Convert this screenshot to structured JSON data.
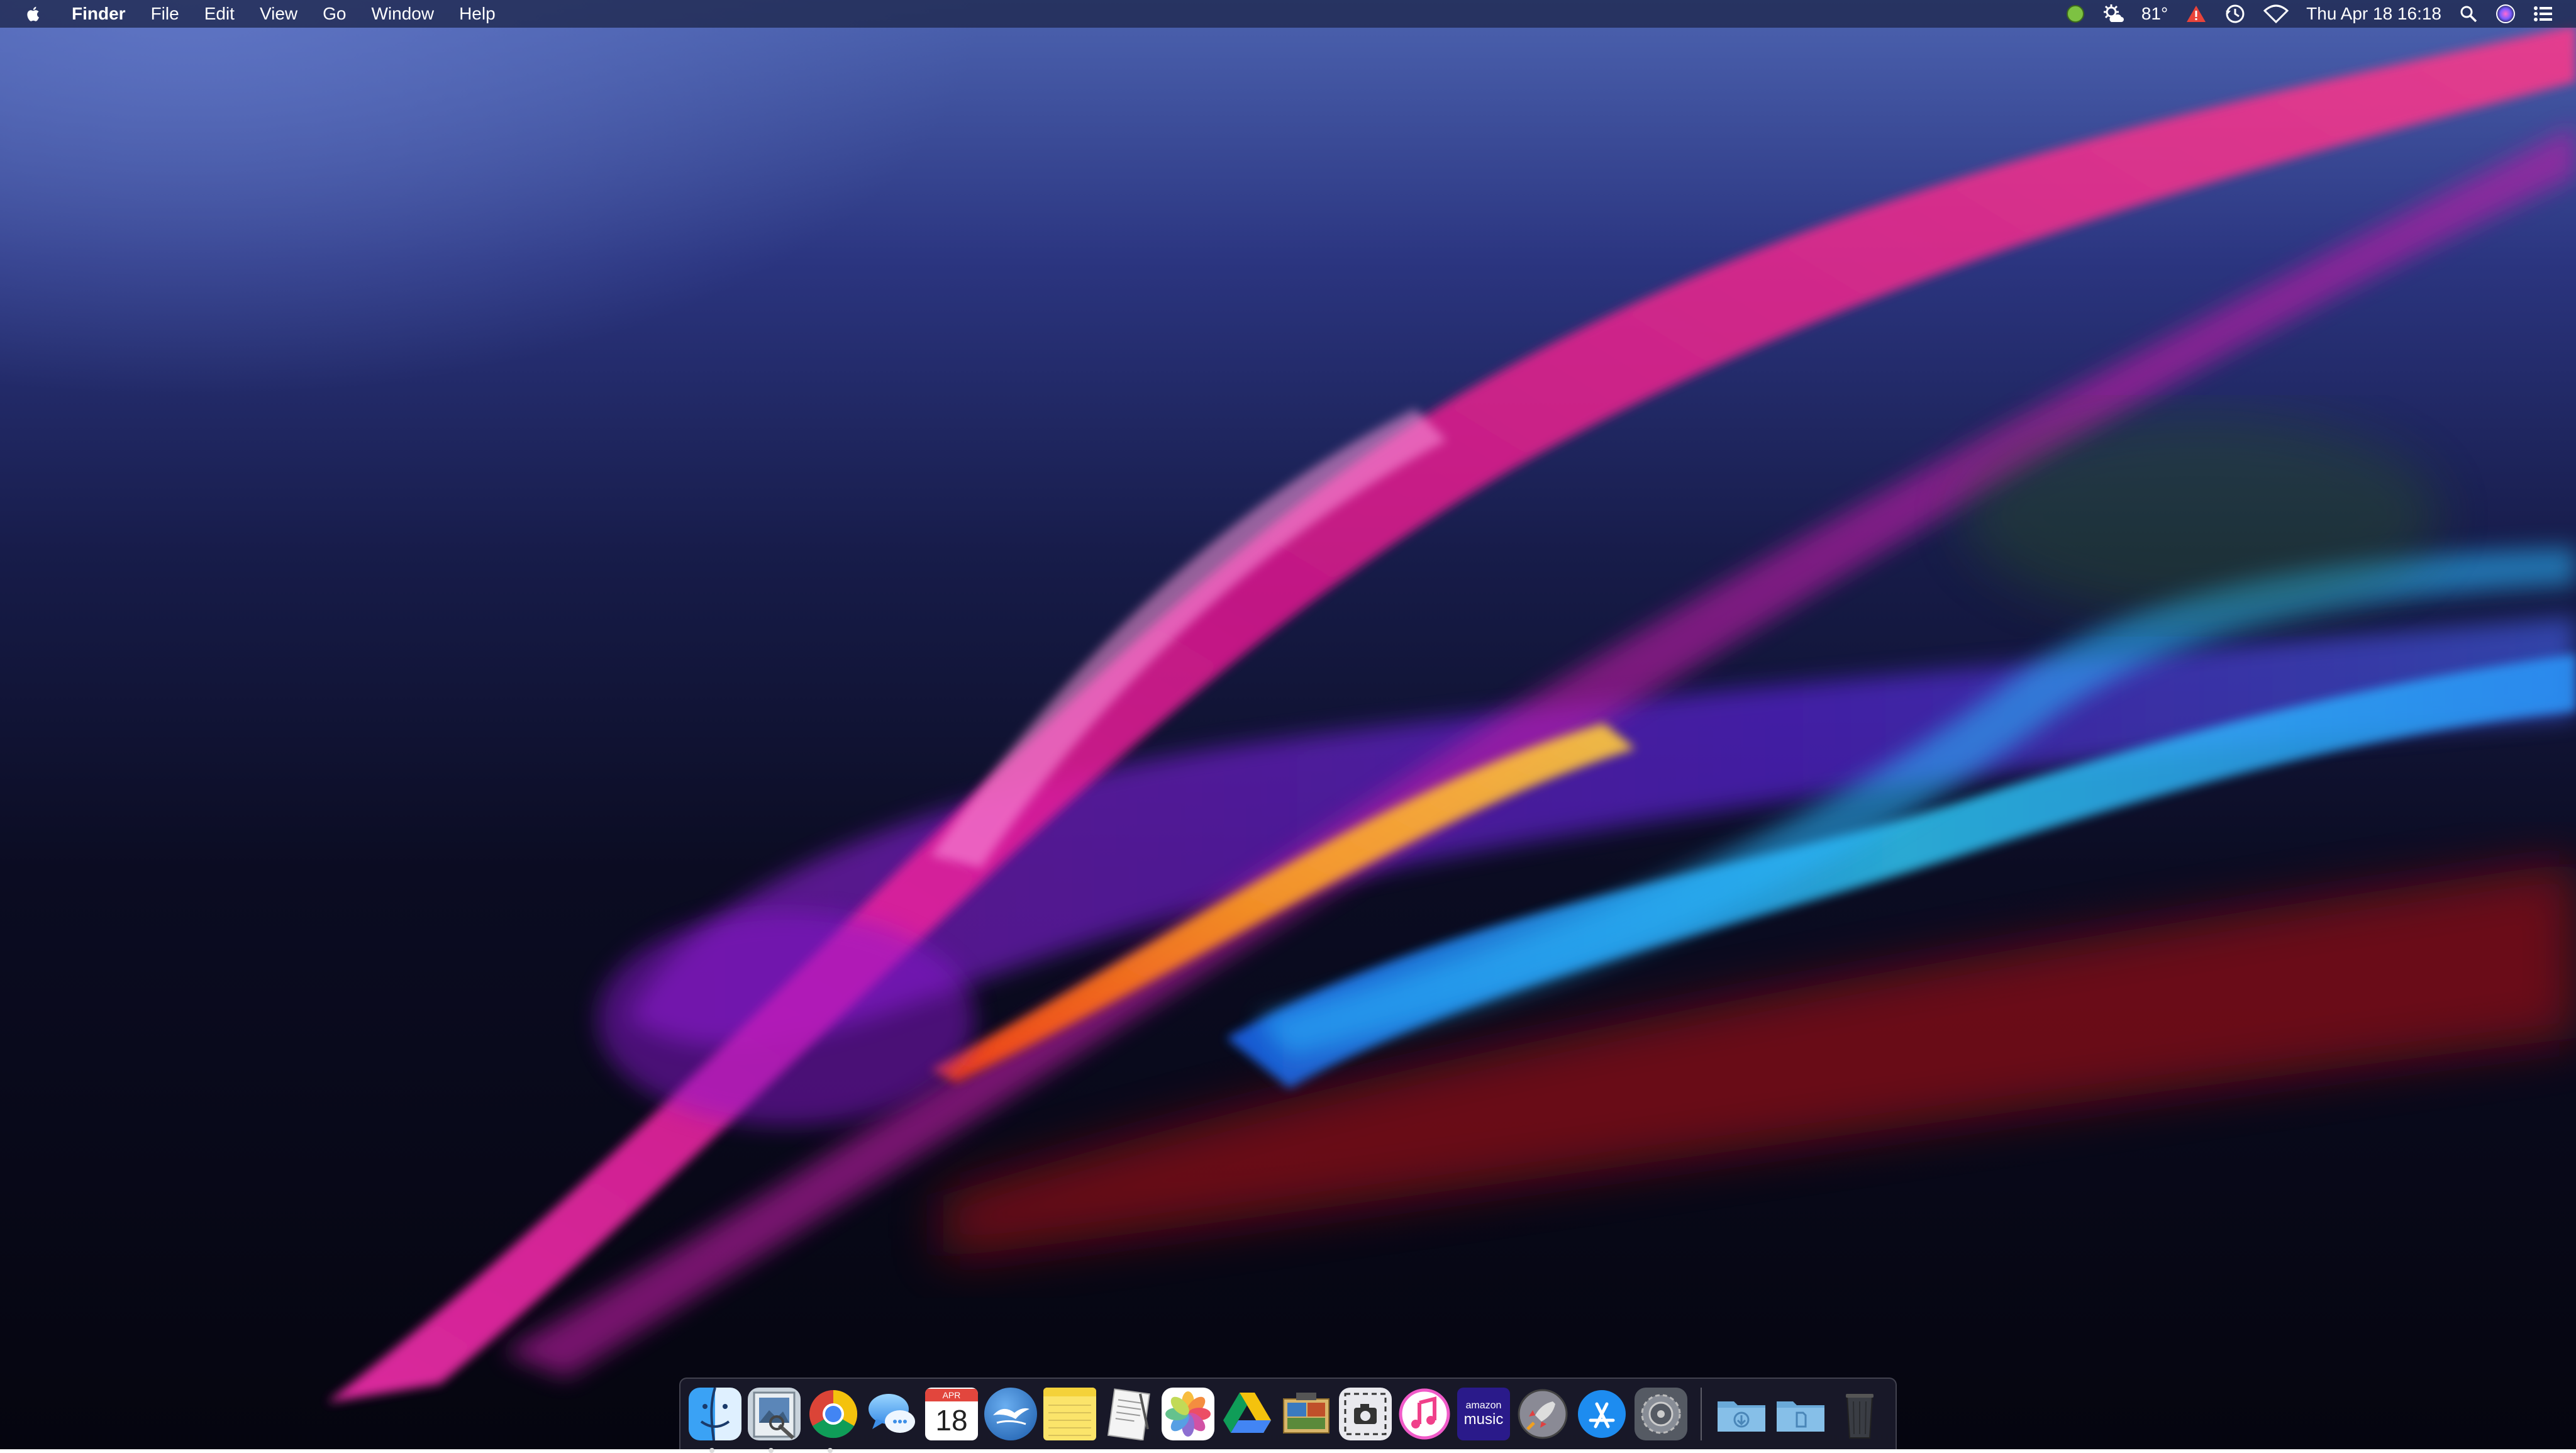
{
  "menubar": {
    "apple_icon": "apple-logo-icon",
    "app_name": "Finder",
    "menus": [
      "File",
      "Edit",
      "View",
      "Go",
      "Window",
      "Help"
    ],
    "status": {
      "temperature": "81°",
      "datetime": "Thu Apr 18  16:18"
    }
  },
  "dock": {
    "apps": [
      {
        "name": "finder",
        "icon": "finder-icon",
        "running": true
      },
      {
        "name": "preview",
        "icon": "preview-icon",
        "running": true
      },
      {
        "name": "chrome",
        "icon": "chrome-icon",
        "running": true
      },
      {
        "name": "messages",
        "icon": "messages-icon",
        "running": false
      },
      {
        "name": "calendar",
        "icon": "calendar-icon",
        "label_month": "APR",
        "label_day": "18",
        "running": false
      },
      {
        "name": "openoffice",
        "icon": "openoffice-icon",
        "running": false
      },
      {
        "name": "notes",
        "icon": "notes-icon",
        "running": false
      },
      {
        "name": "textedit",
        "icon": "textedit-icon",
        "running": false
      },
      {
        "name": "photos",
        "icon": "photos-icon",
        "running": false
      },
      {
        "name": "google-drive",
        "icon": "google-drive-icon",
        "running": false
      },
      {
        "name": "image-capture",
        "icon": "image-capture-icon",
        "running": false
      },
      {
        "name": "screenshot",
        "icon": "screenshot-icon",
        "running": false
      },
      {
        "name": "itunes",
        "icon": "music-note-icon",
        "running": false
      },
      {
        "name": "amazon-music",
        "icon": "amazon-music-icon",
        "label_top": "amazon",
        "label_bottom": "music",
        "running": false
      },
      {
        "name": "launchpad",
        "icon": "rocket-icon",
        "running": false
      },
      {
        "name": "app-store",
        "icon": "app-store-icon",
        "running": false
      },
      {
        "name": "system-preferences",
        "icon": "gear-icon",
        "running": false
      }
    ],
    "folders": [
      {
        "name": "downloads",
        "icon": "downloads-folder-icon"
      },
      {
        "name": "documents",
        "icon": "documents-folder-icon"
      }
    ],
    "trash": {
      "name": "trash",
      "icon": "trash-icon"
    }
  },
  "colors": {
    "menubar_bg": "#1e264b",
    "accent_pink": "#e0249a",
    "accent_purple": "#7a2cff",
    "accent_cyan": "#38c8ff",
    "accent_orange": "#f0a020",
    "accent_red": "#b01818"
  }
}
